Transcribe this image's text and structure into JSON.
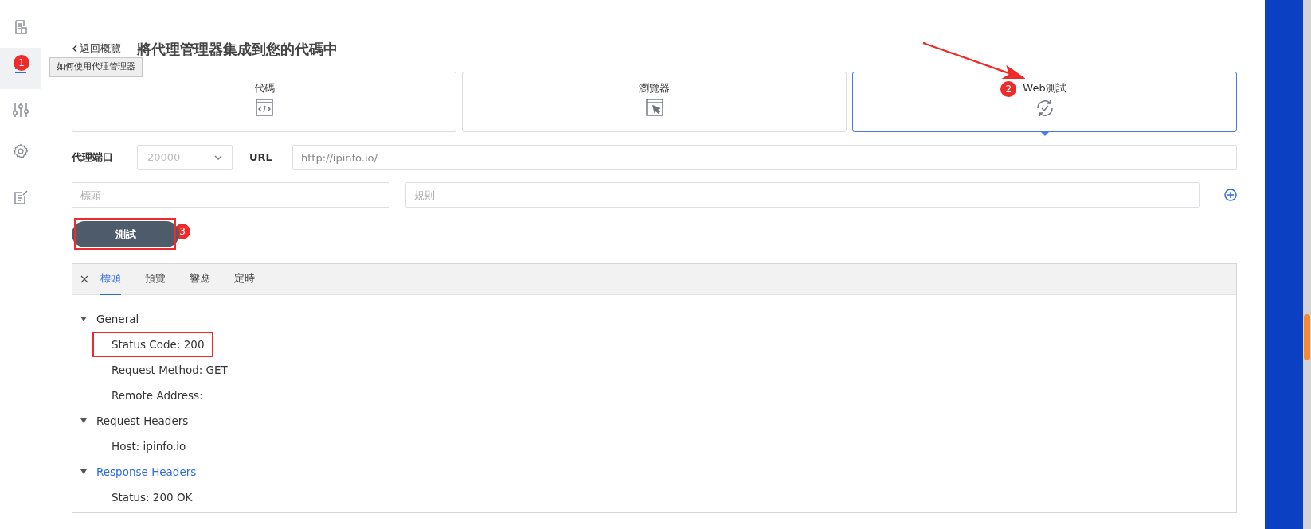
{
  "sidebar": {
    "items": [
      {
        "selected": false
      },
      {
        "selected": true,
        "badge": "1"
      },
      {
        "selected": false
      },
      {
        "selected": false
      },
      {
        "selected": false
      }
    ]
  },
  "tooltip": "如何使用代理管理器",
  "back_link": "返回概覽",
  "title": "將代理管理器集成到您的代碼中",
  "modes": [
    {
      "label": "代碼",
      "selected": false
    },
    {
      "label": "瀏覽器",
      "selected": false
    },
    {
      "label": "Web測試",
      "selected": true,
      "badge": "2"
    }
  ],
  "port": {
    "label": "代理端口",
    "value": "20000"
  },
  "url": {
    "label": "URL",
    "value": "http://ipinfo.io/"
  },
  "header_field": {
    "placeholder": "標頭"
  },
  "rule_field": {
    "placeholder": "規則"
  },
  "test_button": {
    "label": "測試",
    "badge": "3"
  },
  "result_tabs": [
    {
      "label": "標頭",
      "selected": true
    },
    {
      "label": "預覽",
      "selected": false
    },
    {
      "label": "響應",
      "selected": false
    },
    {
      "label": "定時",
      "selected": false
    }
  ],
  "tree": [
    {
      "label": "General",
      "expanded": true,
      "selected": false,
      "children": [
        {
          "label": "Status Code: 200",
          "marked": true
        },
        {
          "label": "Request Method: GET",
          "marked": false
        },
        {
          "label": "Remote Address:",
          "marked": false
        }
      ]
    },
    {
      "label": "Request Headers",
      "expanded": true,
      "selected": false,
      "children": [
        {
          "label": "Host: ipinfo.io",
          "marked": false
        }
      ]
    },
    {
      "label": "Response Headers",
      "expanded": true,
      "selected": true,
      "children": [
        {
          "label": "Status: 200 OK",
          "marked": false
        }
      ]
    }
  ]
}
